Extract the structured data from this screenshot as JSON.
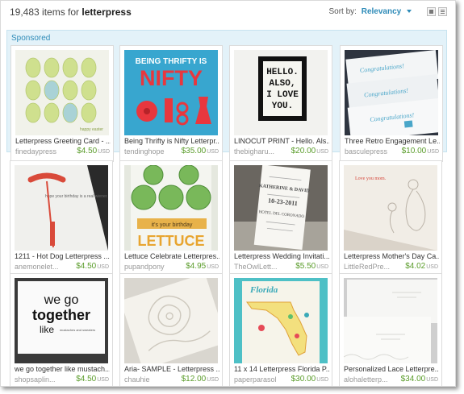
{
  "header": {
    "count": "19,483",
    "count_suffix": "items for",
    "query": "letterpress",
    "sort_label": "Sort by:",
    "sort_value": "Relevancy"
  },
  "sponsored": {
    "label": "Sponsored",
    "items": [
      {
        "title": "Letterpress Greeting Card - ...",
        "shop": "finedaypress",
        "price": "$4.50",
        "currency": "USD"
      },
      {
        "title": "Being Thrifty is Nifty Letterpr...",
        "shop": "tendinghope",
        "price": "$35.00",
        "currency": "USD"
      },
      {
        "title": "LINOCUT PRINT - Hello. Als...",
        "shop": "thebigharu...",
        "price": "$20.00",
        "currency": "USD"
      },
      {
        "title": "Three Retro Engagement Le...",
        "shop": "basculepress",
        "price": "$10.00",
        "currency": "USD"
      }
    ]
  },
  "listings": [
    {
      "title": "1211 - Hot Dog Letterpress ...",
      "shop": "anemonelet...",
      "price": "$4.50",
      "currency": "USD"
    },
    {
      "title": "Lettuce Celebrate Letterpres...",
      "shop": "pupandpony",
      "price": "$4.95",
      "currency": "USD"
    },
    {
      "title": "Letterpress Wedding Invitati...",
      "shop": "TheOwlLett...",
      "price": "$5.50",
      "currency": "USD"
    },
    {
      "title": "Letterpress Mother's Day Ca...",
      "shop": "LittleRedPre...",
      "price": "$4.02",
      "currency": "USD"
    },
    {
      "title": "we go together like mustach...",
      "shop": "shopsaplin...",
      "price": "$4.50",
      "currency": "USD"
    },
    {
      "title": "Aria- SAMPLE - Letterpress ...",
      "shop": "chauhie",
      "price": "$12.00",
      "currency": "USD"
    },
    {
      "title": "11 x 14 Letterpress Florida P...",
      "shop": "paperparasol",
      "price": "$30.00",
      "currency": "USD"
    },
    {
      "title": "Personalized Lace Letterpre...",
      "shop": "alohaletterp...",
      "price": "$34.00",
      "currency": "USD"
    }
  ],
  "thumb_text": {
    "easter": "happy easter",
    "nifty_top": "BEING THRIFTY IS",
    "nifty_big": "NIFTY",
    "hello_lines": [
      "HELLO.",
      "ALSO,",
      "I LOVE",
      "YOU."
    ],
    "congrats": "Congratulations!",
    "hotdog": "hope your birthday is a real wiener.",
    "lettuce_ribbon": "it's your birthday",
    "lettuce_big": "LETTUCE",
    "wedding_names": "KATHERINE & DAVID",
    "wedding_date": "10-23-2011",
    "wedding_place": "HOTEL DEL CORONADO",
    "mother": "Love you mom.",
    "together_lines": [
      "we go",
      "together",
      "like"
    ],
    "together_small": "mustaches and sweaters",
    "florida": "Florida"
  }
}
